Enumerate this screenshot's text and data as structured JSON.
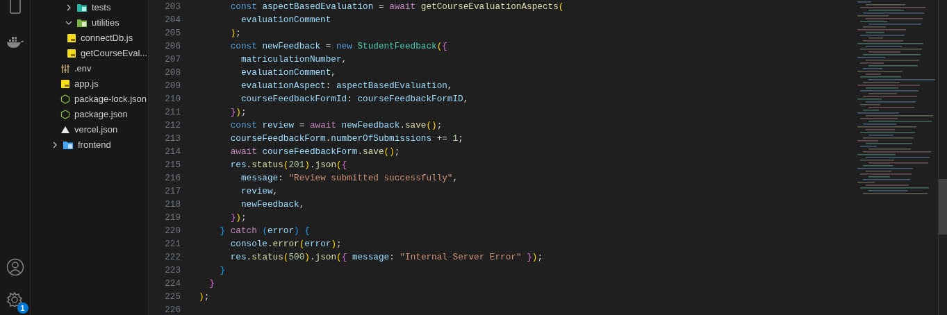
{
  "activity_bar": {
    "badge": "1"
  },
  "explorer": {
    "items": [
      {
        "label": "tests",
        "kind": "folder",
        "expanded": false
      },
      {
        "label": "utilities",
        "kind": "folder",
        "expanded": true,
        "children": [
          {
            "label": "connectDb.js",
            "kind": "js"
          },
          {
            "label": "getCourseEval...",
            "kind": "js"
          }
        ]
      },
      {
        "label": ".env",
        "kind": "env"
      },
      {
        "label": "app.js",
        "kind": "js"
      },
      {
        "label": "package-lock.json",
        "kind": "node"
      },
      {
        "label": "package.json",
        "kind": "node"
      },
      {
        "label": "vercel.json",
        "kind": "vercel"
      }
    ],
    "outer_items": [
      {
        "label": "frontend",
        "kind": "folder",
        "expanded": false
      }
    ]
  },
  "editor": {
    "lines": [
      {
        "number": "203",
        "tokens": [
          {
            "text": "      const",
            "kind": "kw"
          },
          {
            "text": " aspectBasedEvaluation ",
            "kind": "var"
          },
          {
            "text": "= ",
            "kind": "p"
          },
          {
            "text": "await",
            "kind": "ctl"
          },
          {
            "text": " getCourseEvaluationAspects",
            "kind": "fn"
          },
          {
            "text": "(",
            "kind": "b1"
          }
        ]
      },
      {
        "number": "204",
        "tokens": [
          {
            "text": "        evaluationComment",
            "kind": "var"
          }
        ]
      },
      {
        "number": "205",
        "tokens": [
          {
            "text": "      )",
            "kind": "b1"
          },
          {
            "text": ";",
            "kind": "p"
          }
        ]
      },
      {
        "number": "206",
        "tokens": [
          {
            "text": "      const",
            "kind": "kw"
          },
          {
            "text": " newFeedback ",
            "kind": "var"
          },
          {
            "text": "= ",
            "kind": "p"
          },
          {
            "text": "new",
            "kind": "kw"
          },
          {
            "text": " StudentFeedback",
            "kind": "cls"
          },
          {
            "text": "(",
            "kind": "b1"
          },
          {
            "text": "{",
            "kind": "b2"
          }
        ]
      },
      {
        "number": "207",
        "tokens": [
          {
            "text": "        matriculationNumber",
            "kind": "var"
          },
          {
            "text": ",",
            "kind": "p"
          }
        ]
      },
      {
        "number": "208",
        "tokens": [
          {
            "text": "        evaluationComment",
            "kind": "var"
          },
          {
            "text": ",",
            "kind": "p"
          }
        ]
      },
      {
        "number": "209",
        "tokens": [
          {
            "text": "        evaluationAspect",
            "kind": "var"
          },
          {
            "text": ": ",
            "kind": "p"
          },
          {
            "text": "aspectBasedEvaluation",
            "kind": "var"
          },
          {
            "text": ",",
            "kind": "p"
          }
        ]
      },
      {
        "number": "210",
        "tokens": [
          {
            "text": "        courseFeedbackFormId",
            "kind": "var"
          },
          {
            "text": ": ",
            "kind": "p"
          },
          {
            "text": "courseFeedbackFormID",
            "kind": "var"
          },
          {
            "text": ",",
            "kind": "p"
          }
        ]
      },
      {
        "number": "211",
        "tokens": [
          {
            "text": "      }",
            "kind": "b2"
          },
          {
            "text": ")",
            "kind": "b1"
          },
          {
            "text": ";",
            "kind": "p"
          }
        ]
      },
      {
        "number": "212",
        "tokens": [
          {
            "text": "      const",
            "kind": "kw"
          },
          {
            "text": " review ",
            "kind": "var"
          },
          {
            "text": "= ",
            "kind": "p"
          },
          {
            "text": "await",
            "kind": "ctl"
          },
          {
            "text": " newFeedback",
            "kind": "var"
          },
          {
            "text": ".",
            "kind": "p"
          },
          {
            "text": "save",
            "kind": "fn"
          },
          {
            "text": "()",
            "kind": "b1"
          },
          {
            "text": ";",
            "kind": "p"
          }
        ]
      },
      {
        "number": "213",
        "tokens": [
          {
            "text": "      courseFeedbackForm",
            "kind": "var"
          },
          {
            "text": ".",
            "kind": "p"
          },
          {
            "text": "numberOfSubmissions",
            "kind": "var"
          },
          {
            "text": " += ",
            "kind": "p"
          },
          {
            "text": "1",
            "kind": "num"
          },
          {
            "text": ";",
            "kind": "p"
          }
        ]
      },
      {
        "number": "214",
        "tokens": [
          {
            "text": "      await",
            "kind": "ctl"
          },
          {
            "text": " courseFeedbackForm",
            "kind": "var"
          },
          {
            "text": ".",
            "kind": "p"
          },
          {
            "text": "save",
            "kind": "fn"
          },
          {
            "text": "()",
            "kind": "b1"
          },
          {
            "text": ";",
            "kind": "p"
          }
        ]
      },
      {
        "number": "215",
        "tokens": [
          {
            "text": "      res",
            "kind": "var"
          },
          {
            "text": ".",
            "kind": "p"
          },
          {
            "text": "status",
            "kind": "fn"
          },
          {
            "text": "(",
            "kind": "b1"
          },
          {
            "text": "201",
            "kind": "num"
          },
          {
            "text": ")",
            "kind": "b1"
          },
          {
            "text": ".",
            "kind": "p"
          },
          {
            "text": "json",
            "kind": "fn"
          },
          {
            "text": "(",
            "kind": "b1"
          },
          {
            "text": "{",
            "kind": "b2"
          }
        ]
      },
      {
        "number": "216",
        "tokens": [
          {
            "text": "        message",
            "kind": "var"
          },
          {
            "text": ": ",
            "kind": "p"
          },
          {
            "text": "\"Review submitted successfully\"",
            "kind": "str"
          },
          {
            "text": ",",
            "kind": "p"
          }
        ]
      },
      {
        "number": "217",
        "tokens": [
          {
            "text": "        review",
            "kind": "var"
          },
          {
            "text": ",",
            "kind": "p"
          }
        ]
      },
      {
        "number": "218",
        "tokens": [
          {
            "text": "        newFeedback",
            "kind": "var"
          },
          {
            "text": ",",
            "kind": "p"
          }
        ]
      },
      {
        "number": "219",
        "tokens": [
          {
            "text": "      }",
            "kind": "b2"
          },
          {
            "text": ")",
            "kind": "b1"
          },
          {
            "text": ";",
            "kind": "p"
          }
        ]
      },
      {
        "number": "220",
        "tokens": [
          {
            "text": "    }",
            "kind": "b3"
          },
          {
            "text": " catch ",
            "kind": "ctl"
          },
          {
            "text": "(",
            "kind": "b3"
          },
          {
            "text": "error",
            "kind": "var"
          },
          {
            "text": ")",
            "kind": "b3"
          },
          {
            "text": " {",
            "kind": "b3"
          }
        ]
      },
      {
        "number": "221",
        "tokens": [
          {
            "text": "      console",
            "kind": "var"
          },
          {
            "text": ".",
            "kind": "p"
          },
          {
            "text": "error",
            "kind": "fn"
          },
          {
            "text": "(",
            "kind": "b1"
          },
          {
            "text": "error",
            "kind": "var"
          },
          {
            "text": ")",
            "kind": "b1"
          },
          {
            "text": ";",
            "kind": "p"
          }
        ]
      },
      {
        "number": "222",
        "tokens": [
          {
            "text": "      res",
            "kind": "var"
          },
          {
            "text": ".",
            "kind": "p"
          },
          {
            "text": "status",
            "kind": "fn"
          },
          {
            "text": "(",
            "kind": "b1"
          },
          {
            "text": "500",
            "kind": "num"
          },
          {
            "text": ")",
            "kind": "b1"
          },
          {
            "text": ".",
            "kind": "p"
          },
          {
            "text": "json",
            "kind": "fn"
          },
          {
            "text": "(",
            "kind": "b1"
          },
          {
            "text": "{",
            "kind": "b2"
          },
          {
            "text": " message",
            "kind": "var"
          },
          {
            "text": ": ",
            "kind": "p"
          },
          {
            "text": "\"Internal Server Error\" ",
            "kind": "str"
          },
          {
            "text": "}",
            "kind": "b2"
          },
          {
            "text": ")",
            "kind": "b1"
          },
          {
            "text": ";",
            "kind": "p"
          }
        ]
      },
      {
        "number": "223",
        "tokens": [
          {
            "text": "    }",
            "kind": "b3"
          }
        ]
      },
      {
        "number": "224",
        "tokens": [
          {
            "text": "  }",
            "kind": "b2"
          }
        ]
      },
      {
        "number": "225",
        "tokens": [
          {
            "text": ")",
            "kind": "b1"
          },
          {
            "text": ";",
            "kind": "p"
          }
        ]
      },
      {
        "number": "226"
      }
    ]
  }
}
